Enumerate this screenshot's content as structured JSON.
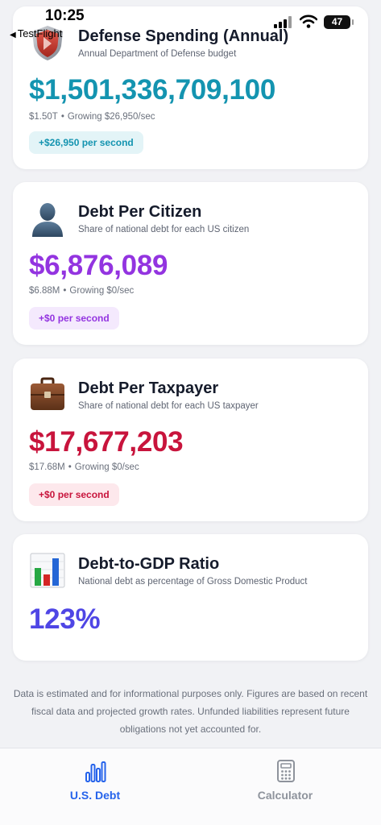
{
  "status_bar": {
    "time": "10:25",
    "back_app": "TestFlight",
    "battery": "47",
    "icons": [
      "signal-icon",
      "wifi-icon",
      "battery-icon"
    ]
  },
  "cards": [
    {
      "icon": "shield-icon",
      "title": "Defense Spending (Annual)",
      "subtitle": "Annual Department of Defense budget",
      "value": "$1,501,336,709,100",
      "meta_short": "$1.50T",
      "meta_growth": "Growing $26,950/sec",
      "pill": "+$26,950 per second",
      "color": "#1494b0",
      "pill_bg": "#e3f4f7"
    },
    {
      "icon": "person-icon",
      "title": "Debt Per Citizen",
      "subtitle": "Share of national debt for each US citizen",
      "value": "$6,876,089",
      "meta_short": "$6.88M",
      "meta_growth": "Growing $0/sec",
      "pill": "+$0 per second",
      "color": "#9334e0",
      "pill_bg": "#f4e9fd"
    },
    {
      "icon": "briefcase-icon",
      "title": "Debt Per Taxpayer",
      "subtitle": "Share of national debt for each US taxpayer",
      "value": "$17,677,203",
      "meta_short": "$17.68M",
      "meta_growth": "Growing $0/sec",
      "pill": "+$0 per second",
      "color": "#c8143c",
      "pill_bg": "#fde8ec"
    },
    {
      "icon": "bar-chart-icon",
      "title": "Debt-to-GDP Ratio",
      "subtitle": "National debt as percentage of Gross Domestic Product",
      "value": "123%",
      "color": "#4f46e5"
    }
  ],
  "disclaimer": "Data is estimated and for informational purposes only. Figures are based on recent fiscal data and projected growth rates. Unfunded liabilities represent future obligations not yet accounted for.",
  "tabs": [
    {
      "label": "U.S. Debt",
      "icon": "chart-bars-icon",
      "selected": true,
      "color": "#2563eb"
    },
    {
      "label": "Calculator",
      "icon": "calculator-icon",
      "selected": false,
      "color": "#8e939c"
    }
  ]
}
